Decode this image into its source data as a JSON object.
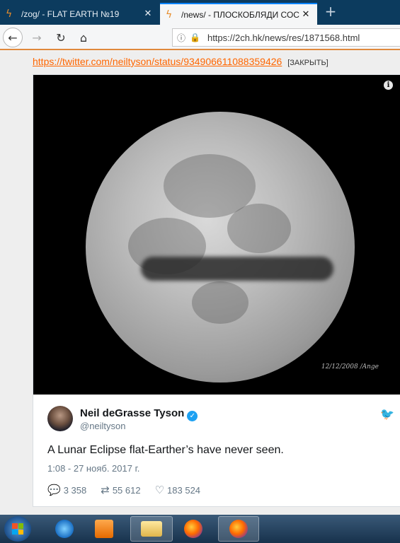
{
  "tabs": [
    {
      "title": "/zog/ - FLAT EARTH №19",
      "close": "✕"
    },
    {
      "title": "/news/ - ПЛОСКОБЛЯДИ СОС",
      "close": "✕"
    }
  ],
  "newtab": "+",
  "nav": {
    "back": "←",
    "forward": "→",
    "reload": "↻",
    "home": "⌂",
    "url": "https://2ch.hk/news/res/1871568.html"
  },
  "post": {
    "link": "https://twitter.com/neiltyson/status/934906611088359426",
    "close_label": "[ЗАКРЫТЬ]"
  },
  "tweet": {
    "image_caption": "12/12/2008 /Ange",
    "author_name": "Neil deGrasse Tyson",
    "handle": "@neiltyson",
    "text": "A Lunar Eclipse flat-Earther’s have never seen.",
    "time": "1:08 - 27 нояб. 2017 г.",
    "replies": "3 358",
    "retweets": "55 612",
    "likes": "183 524"
  },
  "colors": {
    "link": "#ff6600",
    "twitter_blue": "#1da1f2",
    "tabbar": "#0c3b5e"
  }
}
